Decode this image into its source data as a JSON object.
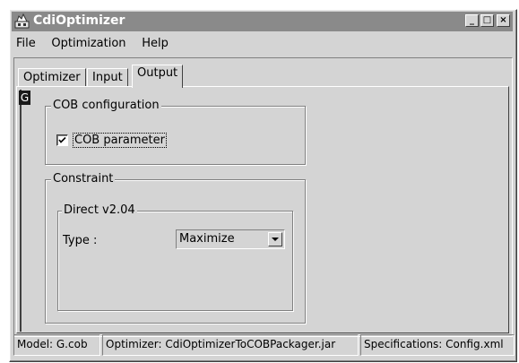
{
  "window": {
    "title": "CdiOptimizer",
    "controls": {
      "minimize": "_",
      "maximize": "□",
      "close": "×"
    }
  },
  "menu": {
    "items": [
      "File",
      "Optimization",
      "Help"
    ]
  },
  "tabs": {
    "items": [
      "Optimizer",
      "Input",
      "Output"
    ],
    "active": "Output"
  },
  "side": {
    "letter": "G"
  },
  "cob_config": {
    "title": "COB configuration",
    "checkbox_label": "COB parameter",
    "checked": true
  },
  "constraint": {
    "title": "Constraint",
    "direct": {
      "title": "Direct v2.04",
      "type_label": "Type :",
      "type_value": "Maximize"
    }
  },
  "status": {
    "model": "Model: G.cob",
    "optimizer": "Optimizer: CdiOptimizerToCOBPackager.jar",
    "specs": "Specifications: Config.xml"
  },
  "icons": {
    "app": "app-icon",
    "checkmark": "checkmark-icon",
    "dropdown": "chevron-down-icon"
  }
}
